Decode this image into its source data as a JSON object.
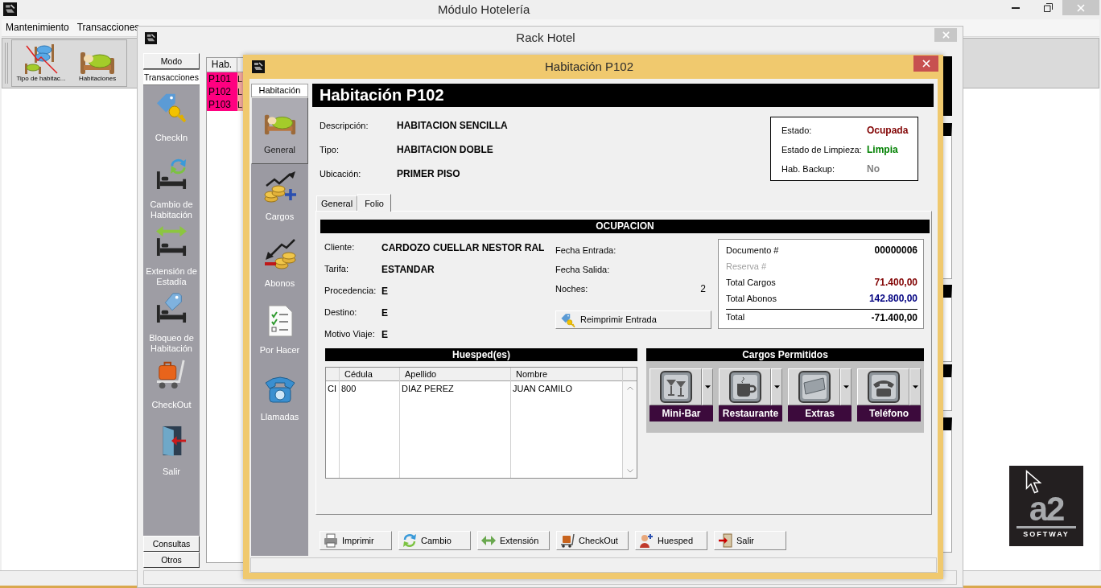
{
  "main_window": {
    "title": "Módulo Hotelería",
    "menu": [
      "Mantenimiento",
      "Transacciones"
    ],
    "toolbar": [
      {
        "label": "Tipo de habitac...",
        "kind": "room-types"
      },
      {
        "label": "Habitaciones",
        "kind": "rooms"
      }
    ],
    "logo": {
      "mark": "a2",
      "tagline": "SOFTWAY"
    }
  },
  "rack_window": {
    "title": "Rack Hotel",
    "sections": [
      {
        "label": "Modo",
        "selected": false
      },
      {
        "label": "Transacciones",
        "selected": true
      },
      {
        "label": "Consultas",
        "selected": false
      },
      {
        "label": "Otros",
        "selected": false
      }
    ],
    "items": [
      {
        "label": "CheckIn",
        "kind": "checkin"
      },
      {
        "label": "Cambio de Habitación",
        "kind": "change"
      },
      {
        "label": "Extensión de Estadía",
        "kind": "extension"
      },
      {
        "label": "Bloqueo de Habitación",
        "kind": "block"
      },
      {
        "label": "CheckOut",
        "kind": "checkout"
      },
      {
        "label": "Salir",
        "kind": "exit"
      }
    ],
    "table": {
      "columns": [
        "Hab."
      ],
      "rows": [
        {
          "room": "P101",
          "column_2": "L",
          "color": "#ff0080"
        },
        {
          "room": "P102",
          "column_2": "L",
          "color": "#ff0080"
        },
        {
          "room": "P103",
          "column_2": "L",
          "color": "#ff0080"
        }
      ]
    }
  },
  "dialog": {
    "title": "Habitación P102",
    "sidebar": {
      "tab": "Habitación",
      "items": [
        {
          "label": "General",
          "kind": "general",
          "selected": true
        },
        {
          "label": "Cargos",
          "kind": "charges",
          "selected": false
        },
        {
          "label": "Abonos",
          "kind": "payments",
          "selected": false
        },
        {
          "label": "Por Hacer",
          "kind": "todo",
          "selected": false
        },
        {
          "label": "Llamadas",
          "kind": "calls",
          "selected": false
        }
      ]
    },
    "heading": "Habitación P102",
    "fields": [
      {
        "label": "Descripción:",
        "value": "HABITACION SENCILLA"
      },
      {
        "label": "Tipo:",
        "value": "HABITACION DOBLE"
      },
      {
        "label": "Ubicación:",
        "value": "PRIMER PISO"
      }
    ],
    "status": [
      {
        "label": "Estado:",
        "value": "Ocupada",
        "color": "#800000"
      },
      {
        "label": "Estado de Limpieza:",
        "value": "Limpia",
        "color": "#008000"
      },
      {
        "label": "Hab. Backup:",
        "value": "No",
        "color": "#808080"
      }
    ],
    "tabs": [
      {
        "label": "General",
        "selected": false
      },
      {
        "label": "Folio",
        "selected": true
      }
    ],
    "folio": {
      "title": "OCUPACION",
      "guest_info": [
        {
          "label": "Cliente:",
          "value": "CARDOZO CUELLAR NESTOR RAL"
        },
        {
          "label": "Tarifa:",
          "value": "ESTANDAR"
        },
        {
          "label": "Procedencia:",
          "value": "E"
        },
        {
          "label": "Destino:",
          "value": "E"
        },
        {
          "label": "Motivo Viaje:",
          "value": "E"
        }
      ],
      "stay": [
        {
          "label": "Fecha Entrada:"
        },
        {
          "label": "Fecha Salida:"
        },
        {
          "label": "Noches:",
          "value": "2"
        }
      ],
      "reprint_button": "Reimprimir Entrada",
      "totals": [
        {
          "label": "Documento #",
          "value": "00000006",
          "kind": "line",
          "disabled": false,
          "color": "#000000"
        },
        {
          "label": "Reserva #",
          "kind": "line",
          "disabled": true
        },
        {
          "label": "Total Cargos",
          "value": "71.400,00",
          "kind": "line",
          "disabled": false,
          "color": "#800000"
        },
        {
          "label": "Total Abonos",
          "value": "142.800,00",
          "kind": "line",
          "disabled": false,
          "color": "#000080"
        },
        {
          "label": "Total",
          "value": "-71.400,00",
          "kind": "sum",
          "disabled": false,
          "color": "#000000"
        }
      ],
      "guests": {
        "title": "Huesped(es)",
        "columns": [
          "",
          "Cédula",
          "Apellido",
          "Nombre"
        ],
        "rows": [
          [
            "CI",
            "800",
            "DIAZ PEREZ",
            "JUAN CAMILO"
          ]
        ]
      },
      "charges": {
        "title": "Cargos Permitidos",
        "items": [
          {
            "label": "Mini-Bar",
            "kind": "minibar"
          },
          {
            "label": "Restaurante",
            "kind": "restaurant"
          },
          {
            "label": "Extras",
            "kind": "extras"
          },
          {
            "label": "Teléfono",
            "kind": "phone"
          }
        ]
      }
    },
    "buttons": [
      {
        "label": "Imprimir",
        "kind": "print"
      },
      {
        "label": "Cambio",
        "kind": "change"
      },
      {
        "label": "Extensión",
        "kind": "extension"
      },
      {
        "label": "CheckOut",
        "kind": "checkout"
      },
      {
        "label": "Huesped",
        "kind": "guest"
      },
      {
        "label": "Salir",
        "kind": "exit"
      }
    ]
  }
}
